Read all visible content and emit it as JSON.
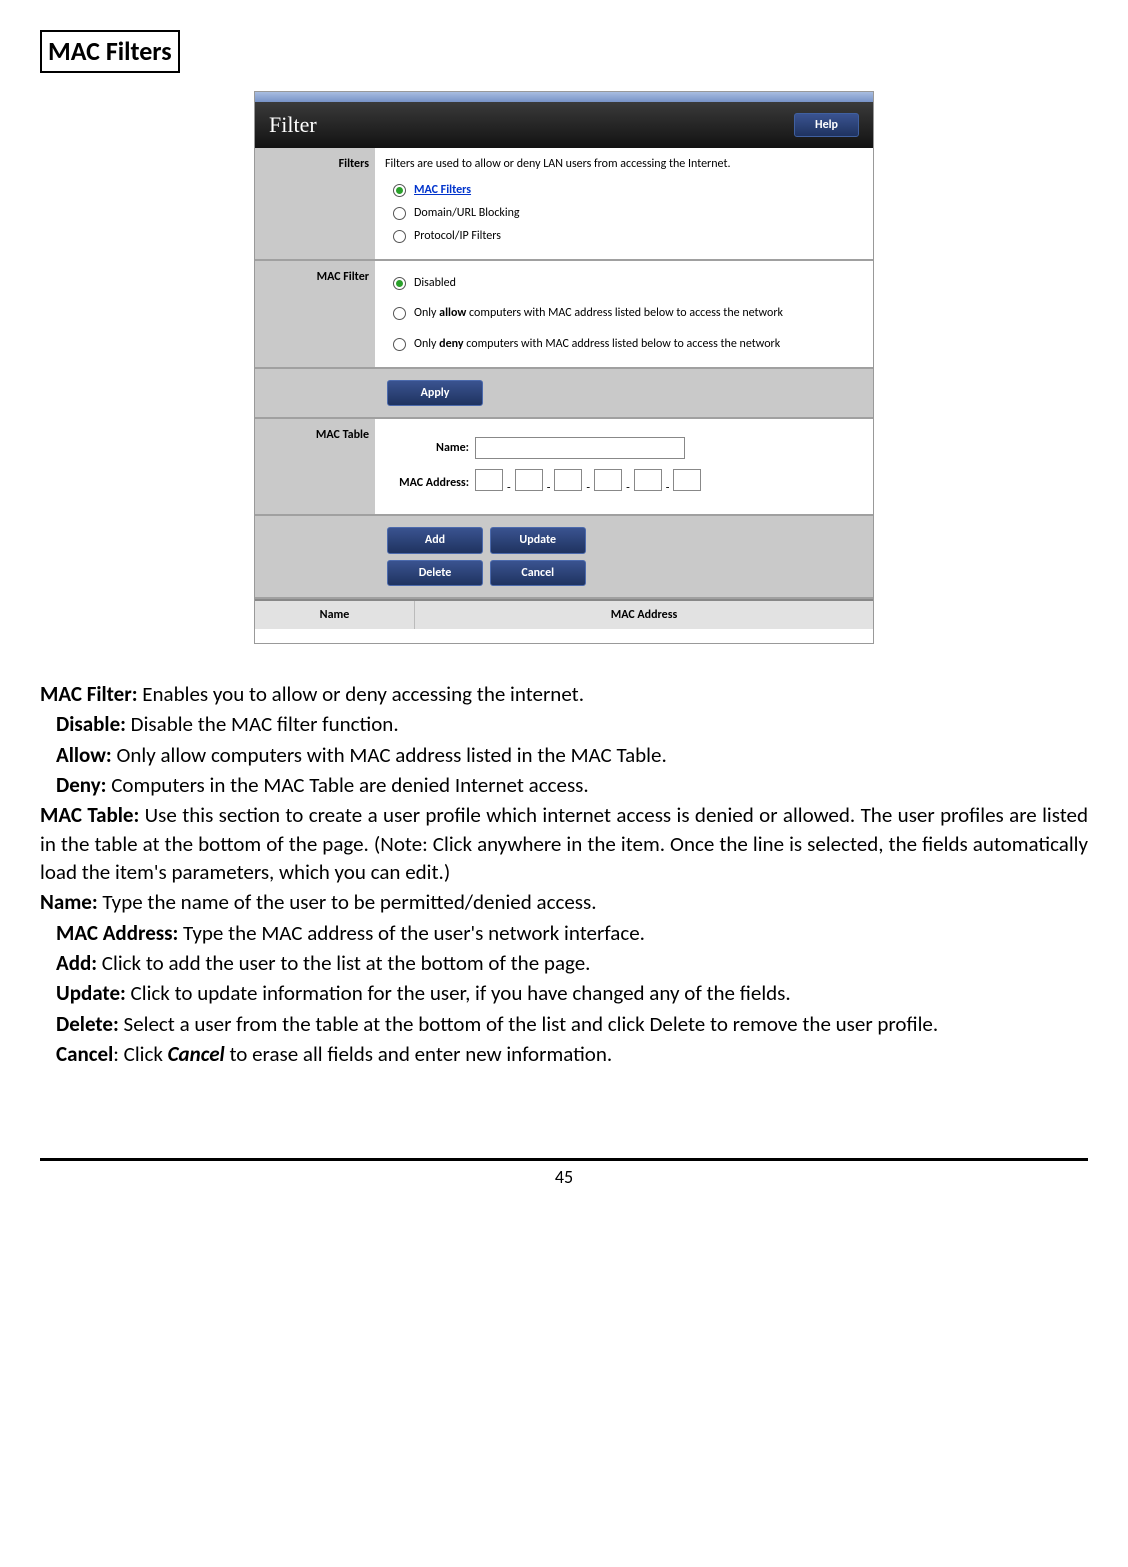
{
  "page": {
    "title": "MAC Filters",
    "number": "45"
  },
  "screenshot": {
    "header_title": "Filter",
    "help_button": "Help",
    "filters": {
      "row_label": "Filters",
      "description": "Filters are used to allow or deny LAN users from accessing the Internet.",
      "options": {
        "mac": "MAC Filters",
        "domain": "Domain/URL Blocking",
        "protocol": "Protocol/IP Filters"
      }
    },
    "macfilter": {
      "row_label": "MAC Filter",
      "disabled": "Disabled",
      "allow_part1": "Only ",
      "allow_bold": "allow",
      "allow_part2": " computers with MAC address listed below to access the network",
      "deny_part1": "Only ",
      "deny_bold": "deny",
      "deny_part2": " computers with MAC address listed below to access the network"
    },
    "buttons": {
      "apply": "Apply",
      "add": "Add",
      "update": "Update",
      "delete": "Delete",
      "cancel": "Cancel"
    },
    "mactable": {
      "row_label": "MAC Table",
      "name_label": "Name:",
      "address_label": "MAC Address:",
      "sep": "-"
    },
    "table_head": {
      "name": "Name",
      "mac": "MAC Address"
    }
  },
  "doc": {
    "mac_filter_label": "MAC Filter:",
    "mac_filter_text": " Enables you to allow or deny accessing the internet.",
    "disable_label": "Disable:",
    "disable_text": " Disable the MAC filter function.",
    "allow_label": "Allow:",
    "allow_text": " Only allow computers with MAC address listed in the MAC Table.",
    "deny_label": "Deny:",
    "deny_text": " Computers in the MAC Table are denied Internet access.",
    "mac_table_label": "MAC Table:",
    "mac_table_text": " Use this section to create a user profile which internet access is denied or allowed.  The user profiles are listed in the table at the bottom of the page.   (Note: Click anywhere in the item. Once the line is selected, the fields automatically load the item's parameters, which you can edit.)",
    "name_label": "Name:",
    "name_text": " Type the name of the user to be permitted/denied access.",
    "macaddr_label": "MAC Address:",
    "macaddr_text": " Type the MAC address of the user's network interface.",
    "add_label": "Add:",
    "add_text": " Click to add the user to the list at the bottom of the page.",
    "update_label": "Update:",
    "update_text": " Click to update information for the user, if you have changed any of the fields.",
    "delete_label": "Delete:",
    "delete_text": " Select a user from the table at the bottom of the list and click Delete to remove the user profile.",
    "cancel_label": "Cancel",
    "cancel_colon": ": Click ",
    "cancel_bolditalic": "Cancel",
    "cancel_text": " to erase all fields and enter new information."
  }
}
